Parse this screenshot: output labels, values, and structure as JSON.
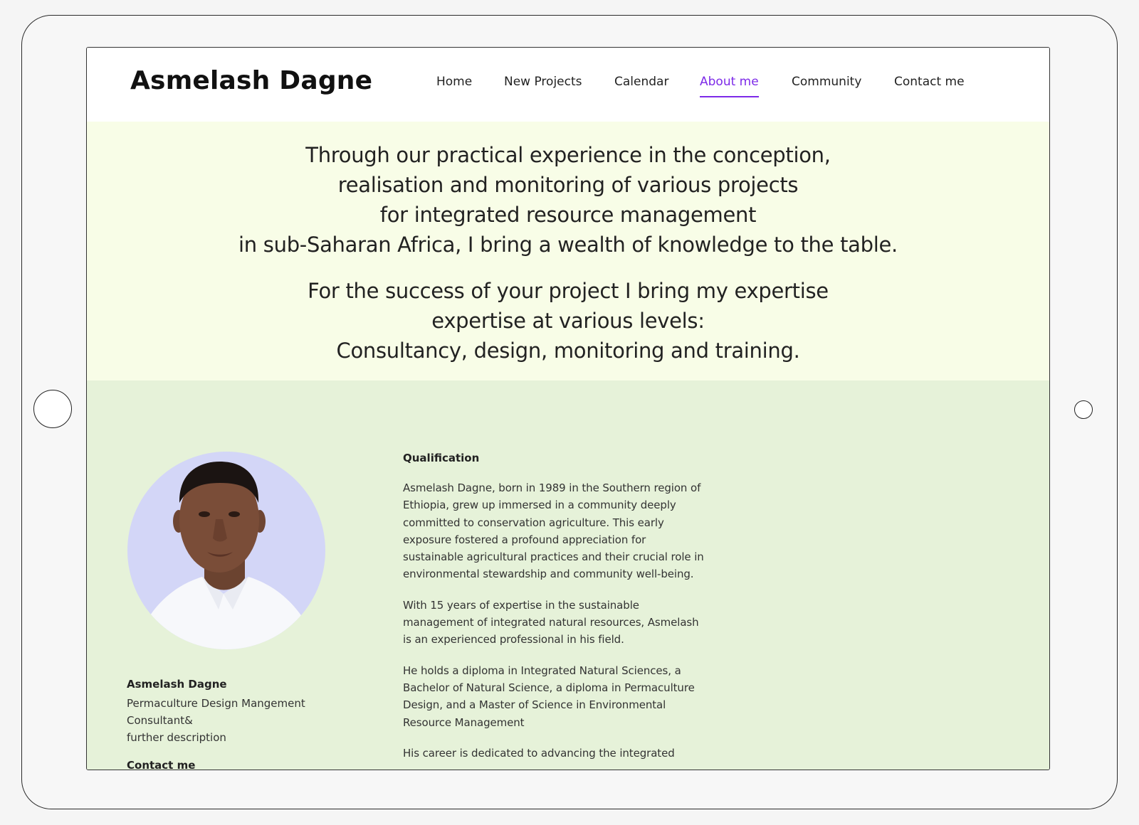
{
  "site": {
    "logo": "Asmelash Dagne"
  },
  "nav": {
    "items": [
      {
        "label": "Home"
      },
      {
        "label": "New Projects"
      },
      {
        "label": "Calendar"
      },
      {
        "label": "About me",
        "active": true
      },
      {
        "label": "Community"
      },
      {
        "label": "Contact me"
      }
    ],
    "active_color": "#7d2ae8"
  },
  "hero": {
    "paragraph1": "Through our practical experience in the conception,\nrealisation and monitoring of various projects\nfor integrated resource management\nin sub-Saharan Africa, I bring a wealth of knowledge to the table.",
    "paragraph2": "For the success of your project I bring my expertise\nexpertise at various levels:\nConsultancy, design, monitoring and training.",
    "background": "#f8fde7"
  },
  "profile": {
    "portrait_icon": "person-portrait",
    "name": "Asmelash Dagne",
    "line1": "Permaculture Design Mangement",
    "line2": "Consultant&",
    "line3": "further description",
    "contact_heading": "Contact me"
  },
  "qualification": {
    "heading": "Qualification",
    "paragraphs": [
      "Asmelash Dagne, born in 1989 in the Southern region of Ethiopia, grew up immersed in a community deeply committed to conservation agriculture. This early exposure fostered a profound appreciation for sustainable agricultural practices and their crucial role in environmental stewardship and community well-being.",
      "With 15 years of expertise in the sustainable management of integrated natural resources, Asmelash is an experienced professional in his field.",
      "He holds a diploma in Integrated Natural Sciences, a Bachelor of Natural Science, a diploma in Permaculture Design, and a Master of Science in Environmental Resource Management",
      "His career is dedicated to advancing the integrated"
    ]
  },
  "colors": {
    "content_background": "#e6f2d9",
    "portrait_background": "#d3d6f7"
  }
}
